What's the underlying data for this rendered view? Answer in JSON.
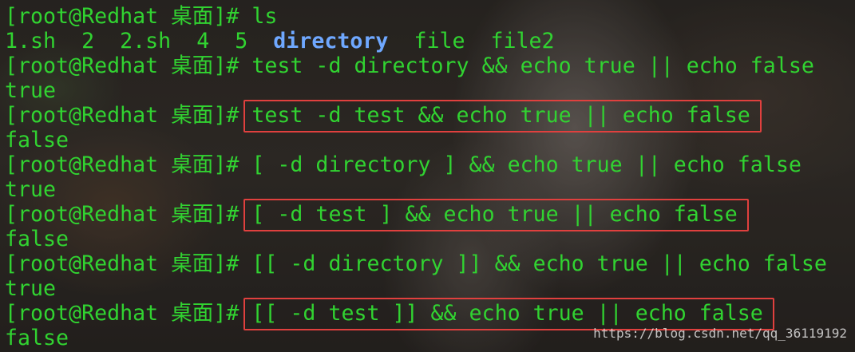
{
  "terminal": {
    "prompt": "[root@Redhat 桌面]# ",
    "lines": [
      {
        "type": "command",
        "cmd": "ls"
      },
      {
        "type": "ls",
        "files": [
          "1.sh",
          "2",
          "2.sh",
          "4",
          "5"
        ],
        "dir": "directory",
        "files_after": [
          "file",
          "file2"
        ]
      },
      {
        "type": "command",
        "cmd": "test -d directory && echo true || echo false"
      },
      {
        "type": "output",
        "text": "true"
      },
      {
        "type": "command",
        "cmd": "test -d test && echo true || echo false",
        "highlight": true
      },
      {
        "type": "output",
        "text": "false"
      },
      {
        "type": "command",
        "cmd": "[ -d directory ] && echo true || echo false"
      },
      {
        "type": "output",
        "text": "true"
      },
      {
        "type": "command",
        "cmd": "[ -d test ] && echo true || echo false",
        "highlight": true
      },
      {
        "type": "output",
        "text": "false"
      },
      {
        "type": "command",
        "cmd": "[[ -d directory ]] && echo true || echo false"
      },
      {
        "type": "output",
        "text": "true"
      },
      {
        "type": "command",
        "cmd": "[[ -d test ]] && echo true || echo false",
        "highlight": true
      },
      {
        "type": "output",
        "text": "false"
      }
    ]
  },
  "watermark": "https://blog.csdn.net/qq_36119192",
  "colors": {
    "text": "#31d331",
    "directory": "#6fa8ff",
    "highlight_border": "#e0403e"
  }
}
